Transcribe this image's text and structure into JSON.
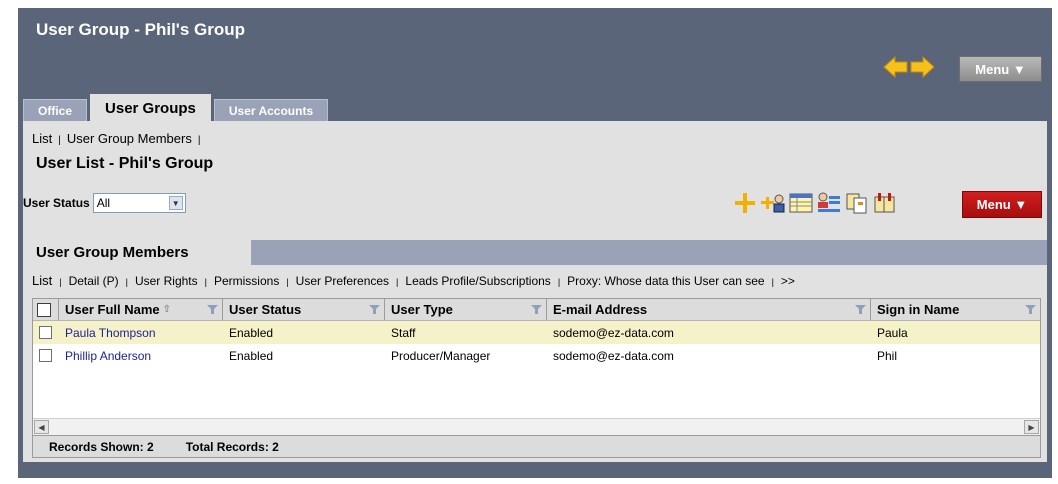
{
  "window": {
    "title": "User Group - Phil's Group"
  },
  "top_nav": {
    "back_icon": "left-arrow-icon",
    "forward_icon": "right-arrow-icon",
    "menu_label": "Menu ▼"
  },
  "tabs": [
    {
      "label": "Office",
      "active": false
    },
    {
      "label": "User Groups",
      "active": true
    },
    {
      "label": "User Accounts",
      "active": false
    }
  ],
  "breadcrumb": {
    "items": [
      "List",
      "User Group Members"
    ]
  },
  "list_title": "User List - Phil's Group",
  "filter": {
    "label": "User Status",
    "value": "All"
  },
  "toolbar": {
    "icons": [
      "add-icon",
      "add-user-icon",
      "list-view-icon",
      "user-list-icon",
      "copy-icon",
      "move-icon"
    ],
    "menu_label": "Menu ▼",
    "menu_color": "#c41414"
  },
  "section": {
    "title": "User Group Members"
  },
  "view_links": [
    "List",
    "Detail (P)",
    "User Rights",
    "Permissions",
    "User Preferences",
    "Leads Profile/Subscriptions",
    "Proxy: Whose data this User can see",
    ">>"
  ],
  "grid": {
    "columns": [
      "User Full Name",
      "User Status",
      "User Type",
      "E-mail Address",
      "Sign in Name"
    ],
    "rows": [
      {
        "name": "Paula Thompson",
        "status": "Enabled",
        "type": "Staff",
        "email": "sodemo@ez-data.com",
        "signin": "Paula",
        "selected": true
      },
      {
        "name": "Phillip Anderson",
        "status": "Enabled",
        "type": "Producer/Manager",
        "email": "sodemo@ez-data.com",
        "signin": "Phil",
        "selected": false
      }
    ]
  },
  "footer": {
    "records_shown": "Records Shown: 2",
    "total_records": "Total Records: 2"
  },
  "colors": {
    "frame": "#5a6579",
    "tab_inactive": "#9aa2b8",
    "panel": "#e1e1e1",
    "selected_row": "#f5f1c9",
    "link": "#1c2594"
  }
}
